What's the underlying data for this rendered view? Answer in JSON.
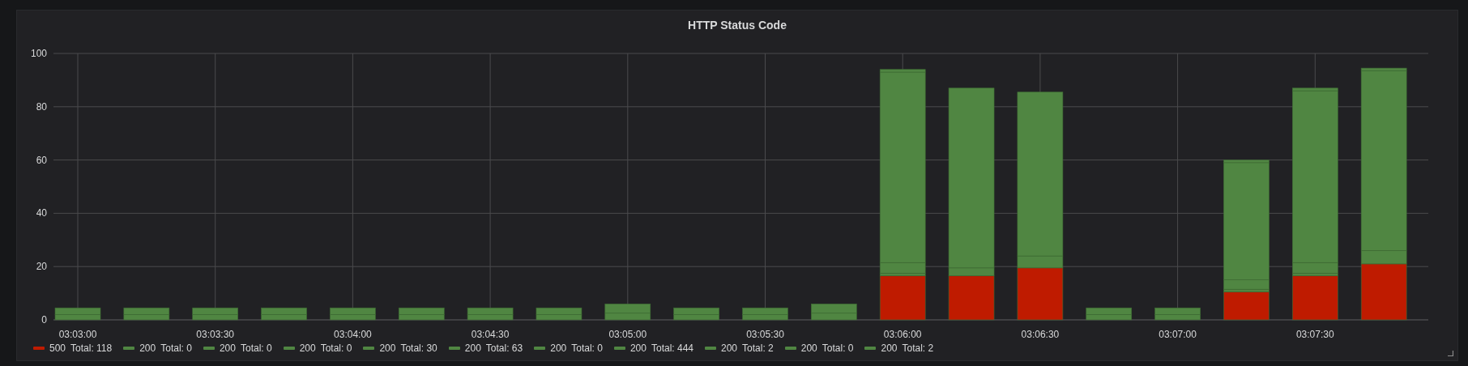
{
  "panel": {
    "title": "HTTP Status Code",
    "chart_data": {
      "type": "bar",
      "stacked": true,
      "ylim": [
        0,
        100
      ],
      "yticks": [
        0,
        20,
        40,
        60,
        80,
        100
      ],
      "grid": true,
      "categories": [
        "03:03:00",
        null,
        "03:03:30",
        null,
        "03:04:00",
        null,
        "03:04:30",
        null,
        "03:05:00",
        null,
        "03:05:30",
        null,
        "03:06:00",
        null,
        "03:06:30",
        null,
        "03:07:00",
        null,
        "03:07:30",
        null
      ],
      "series": [
        {
          "name": "500",
          "color": "#bf1b00",
          "values": [
            0,
            0,
            0,
            0,
            0,
            0,
            0,
            0,
            0,
            0,
            0,
            0,
            16.5,
            16.5,
            19.5,
            0,
            0,
            10.5,
            16.5,
            21
          ]
        },
        {
          "name": "200",
          "color": "#508642",
          "values": [
            0,
            0,
            0,
            0,
            0,
            0,
            0,
            0,
            0,
            0,
            0,
            0,
            0,
            0,
            0,
            0,
            0,
            0,
            0,
            0
          ]
        },
        {
          "name": "200",
          "color": "#508642",
          "values": [
            0,
            0,
            0,
            0,
            0,
            0,
            0,
            0,
            0,
            0,
            0,
            0,
            0,
            0,
            0,
            0,
            0,
            0,
            0,
            0
          ]
        },
        {
          "name": "200",
          "color": "#508642",
          "values": [
            0,
            0,
            0,
            0,
            0,
            0,
            0,
            0,
            0,
            0,
            0,
            0,
            0,
            0,
            0,
            0,
            0,
            0,
            0,
            0
          ]
        },
        {
          "name": "200",
          "color": "#508642",
          "values": [
            2,
            2,
            2,
            2,
            2,
            2,
            2,
            2,
            2.5,
            2,
            2,
            2.5,
            1,
            0,
            0,
            2,
            2,
            1,
            1,
            0
          ]
        },
        {
          "name": "200",
          "color": "#508642",
          "values": [
            0,
            0,
            0,
            0,
            0,
            0,
            0,
            0,
            0,
            0,
            0,
            0,
            4,
            3,
            4.5,
            0,
            0,
            3.5,
            4,
            5
          ]
        },
        {
          "name": "200",
          "color": "#508642",
          "values": [
            0,
            0,
            0,
            0,
            0,
            0,
            0,
            0,
            0,
            0,
            0,
            0,
            0,
            0,
            0,
            0,
            0,
            0,
            0,
            0
          ]
        },
        {
          "name": "200",
          "color": "#508642",
          "values": [
            2.5,
            2.5,
            2.5,
            2.5,
            2.5,
            2.5,
            2.5,
            2.5,
            3.5,
            2.5,
            2.5,
            3.5,
            71.5,
            67.5,
            61.5,
            2.5,
            2.5,
            44,
            64.5,
            67.5
          ]
        },
        {
          "name": "200",
          "color": "#508642",
          "values": [
            0,
            0,
            0,
            0,
            0,
            0,
            0,
            0,
            0,
            0,
            0,
            0,
            1,
            0,
            0,
            0,
            0,
            0,
            0,
            1
          ]
        },
        {
          "name": "200",
          "color": "#508642",
          "values": [
            0,
            0,
            0,
            0,
            0,
            0,
            0,
            0,
            0,
            0,
            0,
            0,
            0,
            0,
            0,
            0,
            0,
            0,
            0,
            0
          ]
        },
        {
          "name": "200",
          "color": "#508642",
          "values": [
            0,
            0,
            0,
            0,
            0,
            0,
            0,
            0,
            0,
            0,
            0,
            0,
            0,
            0,
            0,
            0,
            0,
            1,
            1,
            0
          ]
        }
      ]
    },
    "legend_totals": [
      "Total: 118",
      "Total: 0",
      "Total: 0",
      "Total: 0",
      "Total: 30",
      "Total: 63",
      "Total: 0",
      "Total: 444",
      "Total: 2",
      "Total: 0",
      "Total: 2"
    ]
  }
}
